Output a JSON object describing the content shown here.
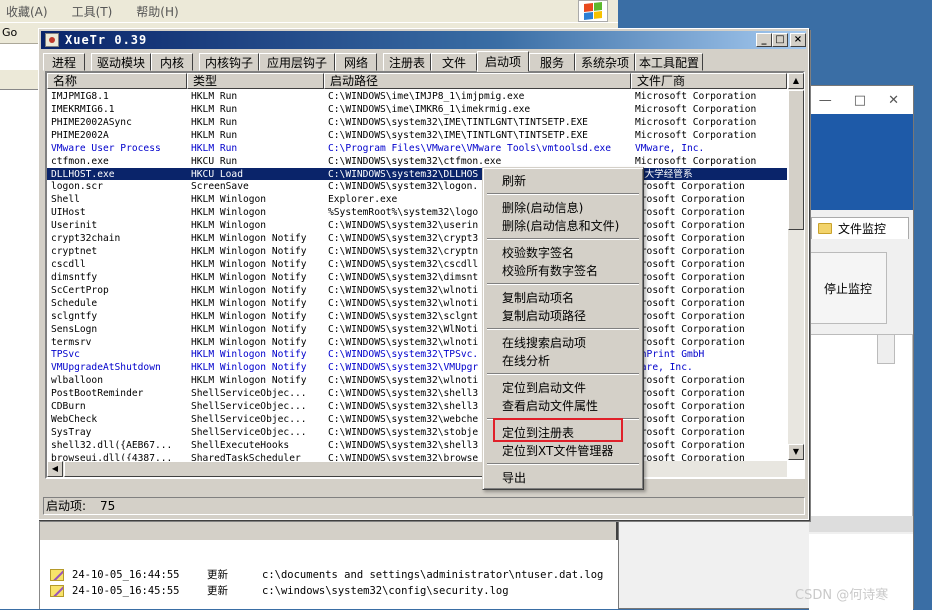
{
  "bg_explorer": {
    "menu": [
      "收藏(A)",
      "工具(T)",
      "帮助(H)"
    ],
    "addr_fragment": "Go",
    "log": [
      {
        "time": "24-10-05_16:44:55",
        "op": "更新",
        "path": "c:\\documents and settings\\administrator\\ntuser.dat.log"
      },
      {
        "time": "24-10-05_16:45:55",
        "op": "更新",
        "path": "c:\\windows\\system32\\config\\security.log"
      }
    ]
  },
  "file_monitor": {
    "controls": [
      "—",
      "□",
      "✕"
    ],
    "tab_label": "文件监控",
    "stop_button": "停止监控"
  },
  "xuetr": {
    "title": "XueTr 0.39",
    "tabs": [
      "进程",
      "驱动模块",
      "内核",
      "内核钩子",
      "应用层钩子",
      "网络",
      "注册表",
      "文件",
      "启动项",
      "服务",
      "系统杂项",
      "本工具配置"
    ],
    "active_tab": "启动项",
    "columns": [
      "名称",
      "类型",
      "启动路径",
      "文件厂商"
    ],
    "rows": [
      [
        "IMJPMIG8.1",
        "HKLM Run",
        "C:\\WINDOWS\\ime\\IMJP8_1\\imjpmig.exe",
        "Microsoft Corporation",
        ""
      ],
      [
        "IMEKRMIG6.1",
        "HKLM Run",
        "C:\\WINDOWS\\ime\\IMKR6_1\\imekrmig.exe",
        "Microsoft Corporation",
        ""
      ],
      [
        "PHIME2002ASync",
        "HKLM Run",
        "C:\\WINDOWS\\system32\\IME\\TINTLGNT\\TINTSETP.EXE",
        "Microsoft Corporation",
        ""
      ],
      [
        "PHIME2002A",
        "HKLM Run",
        "C:\\WINDOWS\\system32\\IME\\TINTLGNT\\TINTSETP.EXE",
        "Microsoft Corporation",
        ""
      ],
      [
        "VMware User Process",
        "HKLM Run",
        "C:\\Program Files\\VMware\\VMware Tools\\vmtoolsd.exe",
        "VMware, Inc.",
        "blue"
      ],
      [
        "ctfmon.exe",
        "HKCU Run",
        "C:\\WINDOWS\\system32\\ctfmon.exe",
        "Microsoft Corporation",
        ""
      ],
      [
        "DLLHOST.exe",
        "HKCU Load",
        "C:\\WINDOWS\\system32\\DLLHOS",
        "强大学经管系",
        "sel"
      ],
      [
        "logon.scr",
        "ScreenSave",
        "C:\\WINDOWS\\system32\\logon.",
        "crosoft Corporation",
        ""
      ],
      [
        "Shell",
        "HKLM Winlogon",
        "Explorer.exe",
        "crosoft Corporation",
        ""
      ],
      [
        "UIHost",
        "HKLM Winlogon",
        "%SystemRoot%\\system32\\logo",
        "crosoft Corporation",
        ""
      ],
      [
        "Userinit",
        "HKLM Winlogon",
        "C:\\WINDOWS\\system32\\userin",
        "crosoft Corporation",
        ""
      ],
      [
        "crypt32chain",
        "HKLM Winlogon Notify",
        "C:\\WINDOWS\\system32\\crypt3",
        "crosoft Corporation",
        ""
      ],
      [
        "cryptnet",
        "HKLM Winlogon Notify",
        "C:\\WINDOWS\\system32\\cryptn",
        "crosoft Corporation",
        ""
      ],
      [
        "cscdll",
        "HKLM Winlogon Notify",
        "C:\\WINDOWS\\system32\\cscdll",
        "crosoft Corporation",
        ""
      ],
      [
        "dimsntfy",
        "HKLM Winlogon Notify",
        "C:\\WINDOWS\\system32\\dimsnt",
        "crosoft Corporation",
        ""
      ],
      [
        "ScCertProp",
        "HKLM Winlogon Notify",
        "C:\\WINDOWS\\system32\\wlnoti",
        "crosoft Corporation",
        ""
      ],
      [
        "Schedule",
        "HKLM Winlogon Notify",
        "C:\\WINDOWS\\system32\\wlnoti",
        "crosoft Corporation",
        ""
      ],
      [
        "sclgntfy",
        "HKLM Winlogon Notify",
        "C:\\WINDOWS\\system32\\sclgnt",
        "crosoft Corporation",
        ""
      ],
      [
        "SensLogn",
        "HKLM Winlogon Notify",
        "C:\\WINDOWS\\system32\\WlNoti",
        "crosoft Corporation",
        ""
      ],
      [
        "termsrv",
        "HKLM Winlogon Notify",
        "C:\\WINDOWS\\system32\\wlnoti",
        "crosoft Corporation",
        ""
      ],
      [
        "TPSvc",
        "HKLM Winlogon Notify",
        "C:\\WINDOWS\\system32\\TPSvc.",
        "inPrint GmbH",
        "blue"
      ],
      [
        "VMUpgradeAtShutdown",
        "HKLM Winlogon Notify",
        "C:\\WINDOWS\\system32\\VMUpgr",
        "ware, Inc.",
        "blue"
      ],
      [
        "wlballoon",
        "HKLM Winlogon Notify",
        "C:\\WINDOWS\\system32\\wlnoti",
        "crosoft Corporation",
        ""
      ],
      [
        "PostBootReminder",
        "ShellServiceObjec...",
        "C:\\WINDOWS\\system32\\shell3",
        "crosoft Corporation",
        ""
      ],
      [
        "CDBurn",
        "ShellServiceObjec...",
        "C:\\WINDOWS\\system32\\shell3",
        "crosoft Corporation",
        ""
      ],
      [
        "WebCheck",
        "ShellServiceObjec...",
        "C:\\WINDOWS\\system32\\webche",
        "crosoft Corporation",
        ""
      ],
      [
        "SysTray",
        "ShellServiceObjec...",
        "C:\\WINDOWS\\system32\\stobje",
        "crosoft Corporation",
        ""
      ],
      [
        "shell32.dll({AEB67...",
        "ShellExecuteHooks",
        "C:\\WINDOWS\\system32\\shell3",
        "crosoft Corporation",
        ""
      ],
      [
        "browseui.dll({4387...",
        "SharedTaskScheduler",
        "C:\\WINDOWS\\system32\\browse",
        "crosoft Corporation",
        ""
      ],
      [
        "browseui.dll({8C74...",
        "SharedTaskScheduler",
        "C:\\WINDOWS\\system32\\browse",
        "crosoft Corporation",
        ""
      ]
    ],
    "status_label": "启动项:",
    "status_count": "75"
  },
  "context_menu": {
    "items": [
      "刷新",
      "删除(启动信息)",
      "删除(启动信息和文件)",
      "校验数字签名",
      "校验所有数字签名",
      "复制启动项名",
      "复制启动项路径",
      "在线搜索启动项",
      "在线分析",
      "定位到启动文件",
      "查看启动文件属性",
      "定位到注册表",
      "定位到XT文件管理器",
      "导出"
    ],
    "highlighted": "定位到注册表"
  },
  "watermark": "CSDN @何诗寒",
  "colors": {
    "selection": "#0a246a",
    "unsigned_text": "#0000cc",
    "highlight_box": "#e0202a",
    "title_bar": "#0a246a"
  }
}
